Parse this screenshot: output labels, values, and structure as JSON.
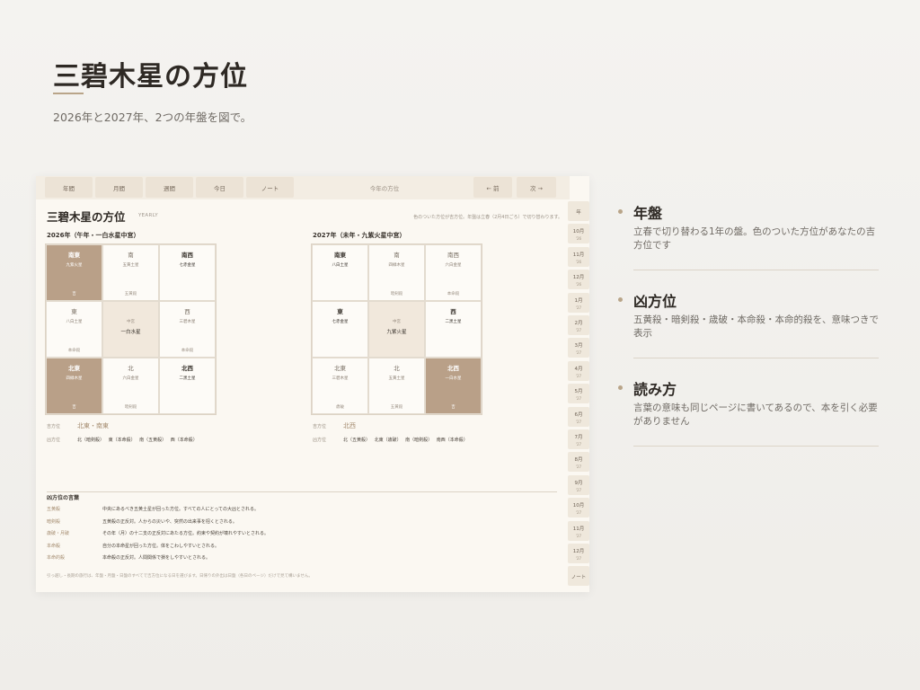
{
  "hero": {
    "title": "三碧木星の方位",
    "subtitle": "2026年と2027年、2つの年盤を図で。"
  },
  "screen": {
    "tabs": [
      "年間",
      "月間",
      "週間",
      "今日",
      "ノート"
    ],
    "center_label": "今年の方位",
    "prev": "← 前",
    "next": "次 →",
    "sidebar": [
      {
        "m": "年",
        "y": ""
      },
      {
        "m": "10月",
        "y": "'26"
      },
      {
        "m": "11月",
        "y": "'26"
      },
      {
        "m": "12月",
        "y": "'26"
      },
      {
        "m": "1月",
        "y": "'27"
      },
      {
        "m": "2月",
        "y": "'27"
      },
      {
        "m": "3月",
        "y": "'27"
      },
      {
        "m": "4月",
        "y": "'27"
      },
      {
        "m": "5月",
        "y": "'27"
      },
      {
        "m": "6月",
        "y": "'27"
      },
      {
        "m": "7月",
        "y": "'27"
      },
      {
        "m": "8月",
        "y": "'27"
      },
      {
        "m": "9月",
        "y": "'27"
      },
      {
        "m": "10月",
        "y": "'27"
      },
      {
        "m": "11月",
        "y": "'27"
      },
      {
        "m": "12月",
        "y": "'27"
      },
      {
        "m": "ノート",
        "y": ""
      }
    ],
    "title": "三碧木星の方位",
    "yearly": "YEARLY",
    "note": "色のついた方位が吉方位。年盤は立春（2月4日ごろ）で切り替わります。",
    "lucky_label": "吉方位",
    "bad_label": "凶方位",
    "year2026": {
      "label": "2026年（午年・一白水星中宮）",
      "cells": [
        {
          "dir": "南東",
          "star": "九紫火星",
          "tag": "吉",
          "hl": true
        },
        {
          "dir": "南",
          "star": "五黄土星",
          "tag": "五黄殺",
          "light": true
        },
        {
          "dir": "南西",
          "star": "七赤金星",
          "tag": "",
          "darkstar": true
        },
        {
          "dir": "東",
          "star": "八白土星",
          "tag": "本命殺",
          "light": true
        },
        {
          "center": true,
          "clab": "中宮",
          "star": "一白水星"
        },
        {
          "dir": "西",
          "star": "三碧木星",
          "tag": "本命殺",
          "light": true
        },
        {
          "dir": "北東",
          "star": "四緑木星",
          "tag": "吉",
          "hl": true
        },
        {
          "dir": "北",
          "star": "六白金星",
          "tag": "暗剣殺",
          "light": true
        },
        {
          "dir": "北西",
          "star": "二黒土星",
          "tag": "",
          "darkstar": true
        }
      ],
      "lucky": "北東・南東",
      "bad": "北（暗剣殺） 東（本命殺） 南（五黄殺） 西（本命殺）"
    },
    "year2027": {
      "label": "2027年（未年・九紫火星中宮）",
      "cells": [
        {
          "dir": "南東",
          "star": "八白土星",
          "tag": "",
          "darkstar": true
        },
        {
          "dir": "南",
          "star": "四緑木星",
          "tag": "暗剣殺",
          "light": true
        },
        {
          "dir": "南西",
          "star": "六白金星",
          "tag": "本命殺",
          "light": true
        },
        {
          "dir": "東",
          "star": "七赤金星",
          "tag": "",
          "darkstar": true
        },
        {
          "center": true,
          "clab": "中宮",
          "star": "九紫火星"
        },
        {
          "dir": "西",
          "star": "二黒土星",
          "tag": "",
          "darkstar": true
        },
        {
          "dir": "北東",
          "star": "三碧木星",
          "tag": "歳破",
          "light": true
        },
        {
          "dir": "北",
          "star": "五黄土星",
          "tag": "五黄殺",
          "light": true
        },
        {
          "dir": "北西",
          "star": "一白水星",
          "tag": "吉",
          "hl": true
        }
      ],
      "lucky": "北西",
      "bad": "北（五黄殺） 北東（歳破） 南（暗剣殺） 南西（本命殺）"
    },
    "glossary": {
      "title": "凶方位の言葉",
      "items": [
        {
          "k": "五黄殺",
          "v": "中央にあるべき五黄土星が回った方位。すべての人にとっての大凶とされる。"
        },
        {
          "k": "暗剣殺",
          "v": "五黄殺の正反対。人からの災いや、突然の出来事を招くとされる。"
        },
        {
          "k": "歳破・月破",
          "v": "その年（月）の十二支の正反対にあたる方位。約束や契約が壊れやすいとされる。"
        },
        {
          "k": "本命殺",
          "v": "自分の本命星が回った方位。体をこわしやすいとされる。"
        },
        {
          "k": "本命的殺",
          "v": "本命殺の正反対。人間関係で損をしやすいとされる。"
        }
      ]
    },
    "footer": "引っ越し・長期の旅行は、年盤・月盤・日盤のすべてで吉方位になる日を選びます。日帰りの外出は日盤（各日のページ）だけで見て構いません。"
  },
  "features": [
    {
      "title": "年盤",
      "desc": "立春で切り替わる1年の盤。色のついた方位があなたの吉方位です"
    },
    {
      "title": "凶方位",
      "desc": "五黄殺・暗剣殺・歳破・本命殺・本命的殺を、意味つきで表示"
    },
    {
      "title": "読み方",
      "desc": "言葉の意味も同じページに書いてあるので、本を引く必要がありません"
    }
  ]
}
